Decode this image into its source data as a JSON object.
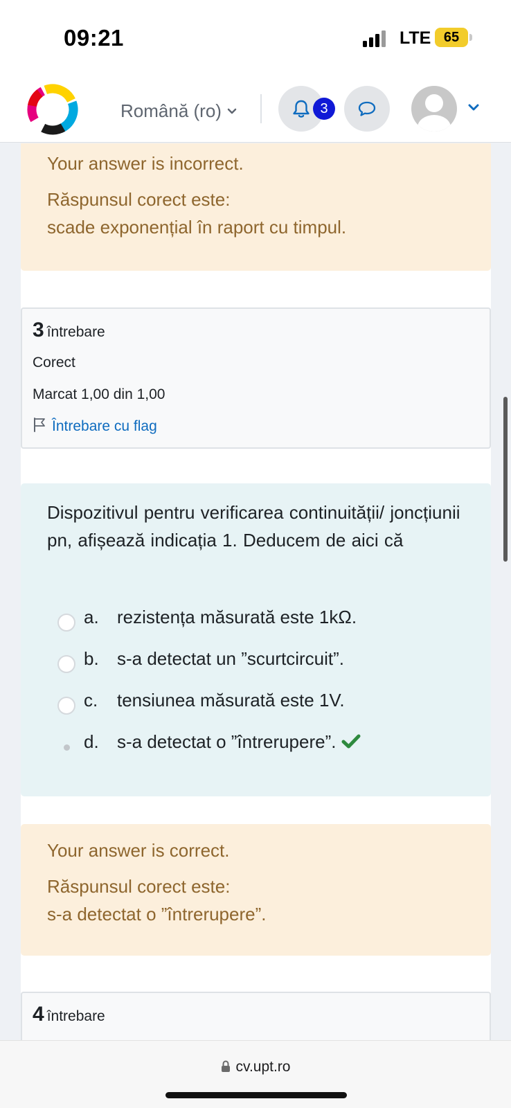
{
  "status_bar": {
    "time": "09:21",
    "network": "LTE",
    "battery": "65"
  },
  "header": {
    "language": "Română (ro)",
    "notification_count": "3",
    "icons": [
      "logo",
      "chevron-down-icon",
      "bell-icon",
      "message-icon",
      "avatar",
      "chevron-down-icon"
    ]
  },
  "feedback_top": {
    "status": "Your answer is incorrect.",
    "correct_label": "Răspunsul corect este:",
    "correct_answer": "scade exponențial în raport cu timpul."
  },
  "question3": {
    "number": "3",
    "label": "întrebare",
    "state": "Corect",
    "grade": "Marcat 1,00 din 1,00",
    "flag": "Întrebare cu flag",
    "text": "Dispozitivul pentru verificarea  continuității/ joncțiunii pn,  afișează indicația 1. Deducem de aici că",
    "answers": [
      {
        "letter": "a.",
        "text": "rezistența măsurată este 1kΩ."
      },
      {
        "letter": "b.",
        "text": "s-a detectat un ”scurtcircuit”."
      },
      {
        "letter": "c.",
        "text": "tensiunea măsurată este 1V."
      },
      {
        "letter": "d.",
        "text": "s-a detectat o ”întrerupere”."
      }
    ],
    "selected": "d."
  },
  "feedback_bottom": {
    "status": "Your answer is correct.",
    "correct_label": "Răspunsul corect este:",
    "correct_answer": "s-a detectat o ”întrerupere”."
  },
  "question4": {
    "number": "4",
    "label": "întrebare"
  },
  "browser": {
    "url": "cv.upt.ro"
  },
  "colors": {
    "feedback_bg": "#fcefdc",
    "feedback_text": "#8e662e",
    "question_bg": "#e7f3f5",
    "link": "#0f6cbf",
    "badge": "#1019d6",
    "correct": "#2e8a3e"
  }
}
